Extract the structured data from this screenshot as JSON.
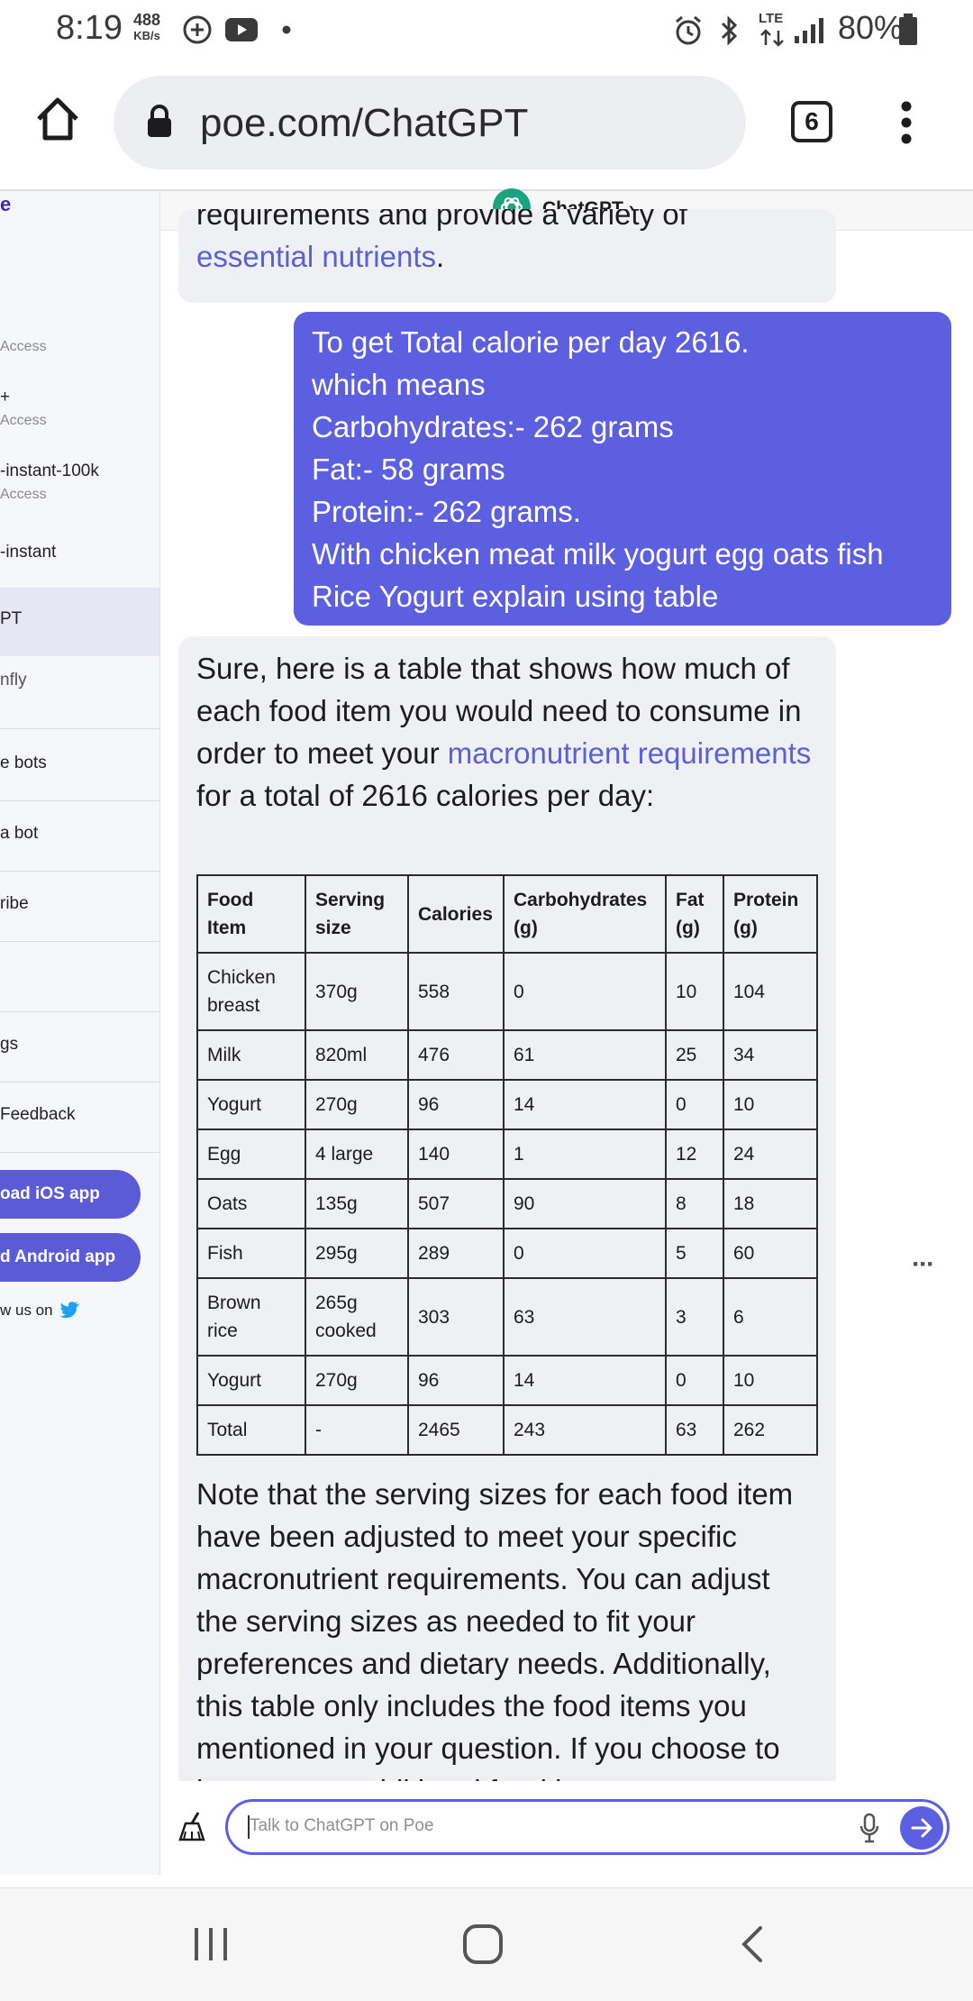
{
  "status_bar": {
    "time": "8:19",
    "net_speed_value": "488",
    "net_speed_unit": "KB/s",
    "battery": "80%",
    "network": "LTE"
  },
  "browser": {
    "url": "poe.com/ChatGPT",
    "tab_count": "6"
  },
  "sidebar": {
    "logo_fragment": "e",
    "items": [
      {
        "label": "",
        "sub": "Access"
      },
      {
        "label": "+",
        "sub": "Access"
      },
      {
        "label": "-instant-100k",
        "sub": "Access"
      },
      {
        "label": "-instant",
        "sub": ""
      },
      {
        "label": "PT",
        "sub": ""
      },
      {
        "label": "nfly",
        "sub": ""
      }
    ],
    "links": [
      "e bots",
      "a bot",
      "ribe",
      "",
      "gs",
      "Feedback"
    ],
    "ios_button": "oad iOS app",
    "android_button": "d Android app",
    "follow_text": "w us on"
  },
  "chat": {
    "header_title": "ChatGPT",
    "bot_msg_top_fragment": "requirements and provide a variety of",
    "bot_msg_top_link": "essential nutrients",
    "bot_msg_top_end": ".",
    "user_message_lines": [
      "To get Total calorie per day 2616.",
      "which means",
      "Carbohydrates:- 262 grams",
      "Fat:- 58 grams",
      "Protein:- 262 grams.",
      "With chicken meat milk yogurt egg oats fish",
      "Rice Yogurt explain using table"
    ],
    "bot_reply": {
      "intro_pre": "Sure, here is a table that shows how much of each food item you would need to consume in order to meet your ",
      "intro_link": "macronutrient requirements",
      "intro_post": " for a total of 2616 calories per day:",
      "table": {
        "headers": [
          "Food Item",
          "Serving size",
          "Calories",
          "Carbohydrates (g)",
          "Fat (g)",
          "Protein (g)"
        ],
        "rows": [
          [
            "Chicken breast",
            "370g",
            "558",
            "0",
            "10",
            "104"
          ],
          [
            "Milk",
            "820ml",
            "476",
            "61",
            "25",
            "34"
          ],
          [
            "Yogurt",
            "270g",
            "96",
            "14",
            "0",
            "10"
          ],
          [
            "Egg",
            "4 large",
            "140",
            "1",
            "12",
            "24"
          ],
          [
            "Oats",
            "135g",
            "507",
            "90",
            "8",
            "18"
          ],
          [
            "Fish",
            "295g",
            "289",
            "0",
            "5",
            "60"
          ],
          [
            "Brown rice",
            "265g cooked",
            "303",
            "63",
            "3",
            "6"
          ],
          [
            "Yogurt",
            "270g",
            "96",
            "14",
            "0",
            "10"
          ],
          [
            "Total",
            "-",
            "2465",
            "243",
            "63",
            "262"
          ]
        ]
      },
      "note": "Note that the serving sizes for each food item have been adjusted to meet your specific macronutrient requirements. You can adjust the serving sizes as needed to fit your preferences and dietary needs. Additionally, this table only includes the food items you mentioned in your question. If you choose to incorporate additional food items, you may"
    },
    "more_options": "···",
    "input_placeholder": "Talk to ChatGPT on Poe"
  },
  "colors": {
    "accent": "#5c5fe0",
    "bot_bubble": "#eef0f3",
    "link": "#5c5fd6"
  }
}
